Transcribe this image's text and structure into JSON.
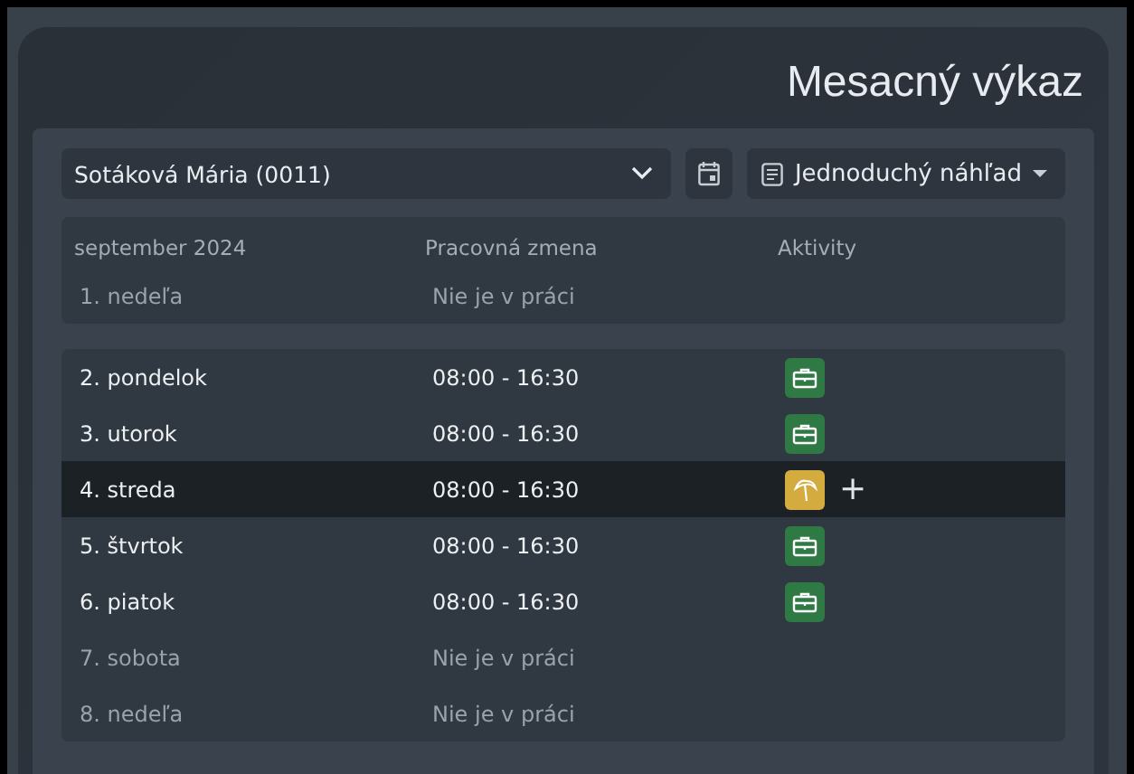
{
  "title": "Mesacný výkaz",
  "toolbar": {
    "employee": "Sotáková Mária (0011)",
    "view": "Jednoduchý náhľad"
  },
  "columns": [
    "september 2024",
    "Pracovná zmena",
    "Aktivity"
  ],
  "weeks": [
    {
      "rows": [
        {
          "day": "1. nedeľa",
          "shift": "Nie je v práci",
          "off": true,
          "selected": false,
          "activities": []
        }
      ]
    },
    {
      "rows": [
        {
          "day": "2. pondelok",
          "shift": "08:00 - 16:30",
          "off": false,
          "selected": false,
          "activities": [
            {
              "kind": "work"
            }
          ]
        },
        {
          "day": "3. utorok",
          "shift": "08:00 - 16:30",
          "off": false,
          "selected": false,
          "activities": [
            {
              "kind": "work"
            }
          ]
        },
        {
          "day": "4. streda",
          "shift": "08:00 - 16:30",
          "off": false,
          "selected": true,
          "activities": [
            {
              "kind": "vacation"
            }
          ],
          "add": "+"
        },
        {
          "day": "5. štvrtok",
          "shift": "08:00 - 16:30",
          "off": false,
          "selected": false,
          "activities": [
            {
              "kind": "work"
            }
          ]
        },
        {
          "day": "6. piatok",
          "shift": "08:00 - 16:30",
          "off": false,
          "selected": false,
          "activities": [
            {
              "kind": "work"
            }
          ]
        },
        {
          "day": "7. sobota",
          "shift": "Nie je v práci",
          "off": true,
          "selected": false,
          "activities": []
        },
        {
          "day": "8. nedeľa",
          "shift": "Nie je v práci",
          "off": true,
          "selected": false,
          "activities": []
        }
      ]
    }
  ]
}
